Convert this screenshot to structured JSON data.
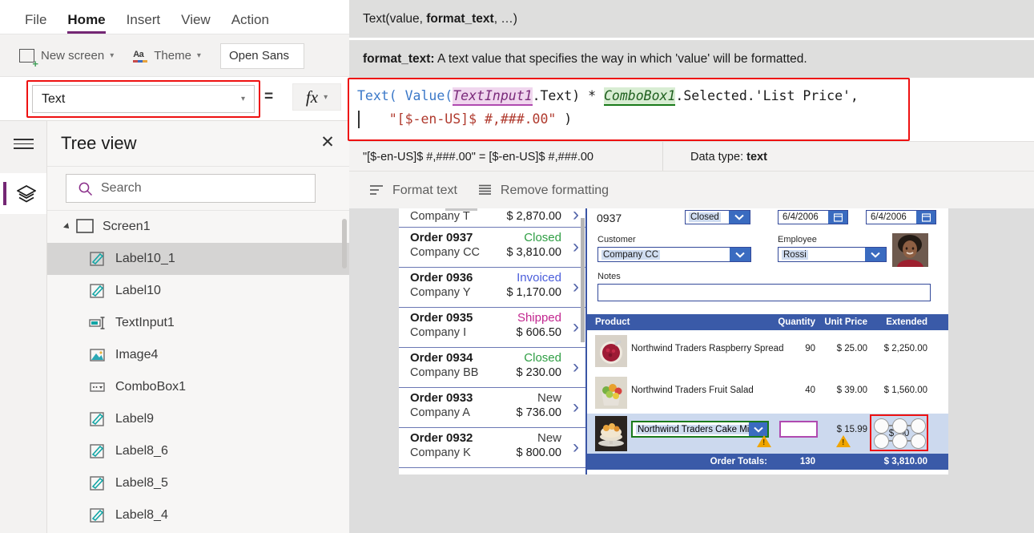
{
  "menubar": {
    "items": [
      "File",
      "Home",
      "Insert",
      "View",
      "Action"
    ],
    "active": "Home"
  },
  "ribbon": {
    "new_screen": "New screen",
    "theme": "Theme",
    "font_value": "Open Sans"
  },
  "property_bar": {
    "selected_property": "Text",
    "equals": "=",
    "fx_label": "fx"
  },
  "tree": {
    "title": "Tree view",
    "search_placeholder": "Search",
    "root": "Screen1",
    "items": [
      {
        "label": "Label10_1",
        "icon": "label-icon",
        "selected": true
      },
      {
        "label": "Label10",
        "icon": "label-icon",
        "selected": false
      },
      {
        "label": "TextInput1",
        "icon": "text-input-icon",
        "selected": false
      },
      {
        "label": "Image4",
        "icon": "image-icon",
        "selected": false
      },
      {
        "label": "ComboBox1",
        "icon": "combobox-icon",
        "selected": false
      },
      {
        "label": "Label9",
        "icon": "label-icon",
        "selected": false
      },
      {
        "label": "Label8_6",
        "icon": "label-icon",
        "selected": false
      },
      {
        "label": "Label8_5",
        "icon": "label-icon",
        "selected": false
      },
      {
        "label": "Label8_4",
        "icon": "label-icon",
        "selected": false
      }
    ]
  },
  "intellisense": {
    "signature_prefix": "Text(value, ",
    "signature_bold": "format_text",
    "signature_suffix": ", …)",
    "param_name": "format_text:",
    "param_desc": " A text value that specifies the way in which 'value' will be formatted."
  },
  "formula": {
    "line1": {
      "fn_text": "Text(",
      "fn_value": " Value(",
      "pill_textinput": "TextInput1",
      "dot_text": ".Text)",
      "star": " * ",
      "pill_combobox": "ComboBox1",
      "tail": ".Selected.'List Price',"
    },
    "line2": {
      "indent": "    ",
      "string": "\"[$-en-US]$ #,###.00\"",
      "close": " )"
    }
  },
  "result_bar": {
    "expression": "\"[$-en-US]$ #,###.00\"  =  [$-en-US]$ #,###.00",
    "datatype_label": "Data type: ",
    "datatype_value": "text"
  },
  "format_bar": {
    "format_text": "Format text",
    "remove_formatting": "Remove formatting"
  },
  "canvas": {
    "gallery": {
      "partial_item": {
        "company": "Company T",
        "amount": "$ 2,870.00"
      },
      "items": [
        {
          "order": "Order 0937",
          "status": "Closed",
          "status_color": "#2f9e44",
          "company": "Company CC",
          "amount": "$ 3,810.00"
        },
        {
          "order": "Order 0936",
          "status": "Invoiced",
          "status_color": "#4a5ddb",
          "company": "Company Y",
          "amount": "$ 1,170.00"
        },
        {
          "order": "Order 0935",
          "status": "Shipped",
          "status_color": "#c2268f",
          "company": "Company I",
          "amount": "$ 606.50"
        },
        {
          "order": "Order 0934",
          "status": "Closed",
          "status_color": "#2f9e44",
          "company": "Company BB",
          "amount": "$ 230.00"
        },
        {
          "order": "Order 0933",
          "status": "New",
          "status_color": "#3b3b3b",
          "company": "Company A",
          "amount": "$ 736.00"
        },
        {
          "order": "Order 0932",
          "status": "New",
          "status_color": "#3b3b3b",
          "company": "Company K",
          "amount": "$ 800.00"
        }
      ]
    },
    "detail": {
      "order_number": "0937",
      "status_value": "Closed",
      "date1": "6/4/2006",
      "date2": "6/4/2006",
      "customer_label": "Customer",
      "customer_value": "Company CC",
      "employee_label": "Employee",
      "employee_value": "Rossi",
      "notes_label": "Notes",
      "notes_value": "",
      "table": {
        "headers": [
          "Product",
          "Quantity",
          "Unit Price",
          "Extended"
        ],
        "rows": [
          {
            "product": "Northwind Traders Raspberry Spread",
            "quantity": "90",
            "unit_price": "$ 25.00",
            "extended": "$ 2,250.00"
          },
          {
            "product": "Northwind Traders Fruit Salad",
            "quantity": "40",
            "unit_price": "$ 39.00",
            "extended": "$ 1,560.00"
          }
        ],
        "edit_row": {
          "product_value": "Northwind Traders Cake Mix",
          "quantity_value": "",
          "unit_price": "$ 15.99",
          "extended": "$ .00"
        },
        "totals_label": "Order Totals:",
        "totals_quantity": "130",
        "totals_extended": "$ 3,810.00"
      }
    }
  },
  "colors": {
    "brand_purple": "#742774",
    "highlight_red": "#ee1111",
    "app_blue": "#3a5aa8",
    "select_green": "#1a7a1a",
    "select_pink": "#b04ab0"
  }
}
